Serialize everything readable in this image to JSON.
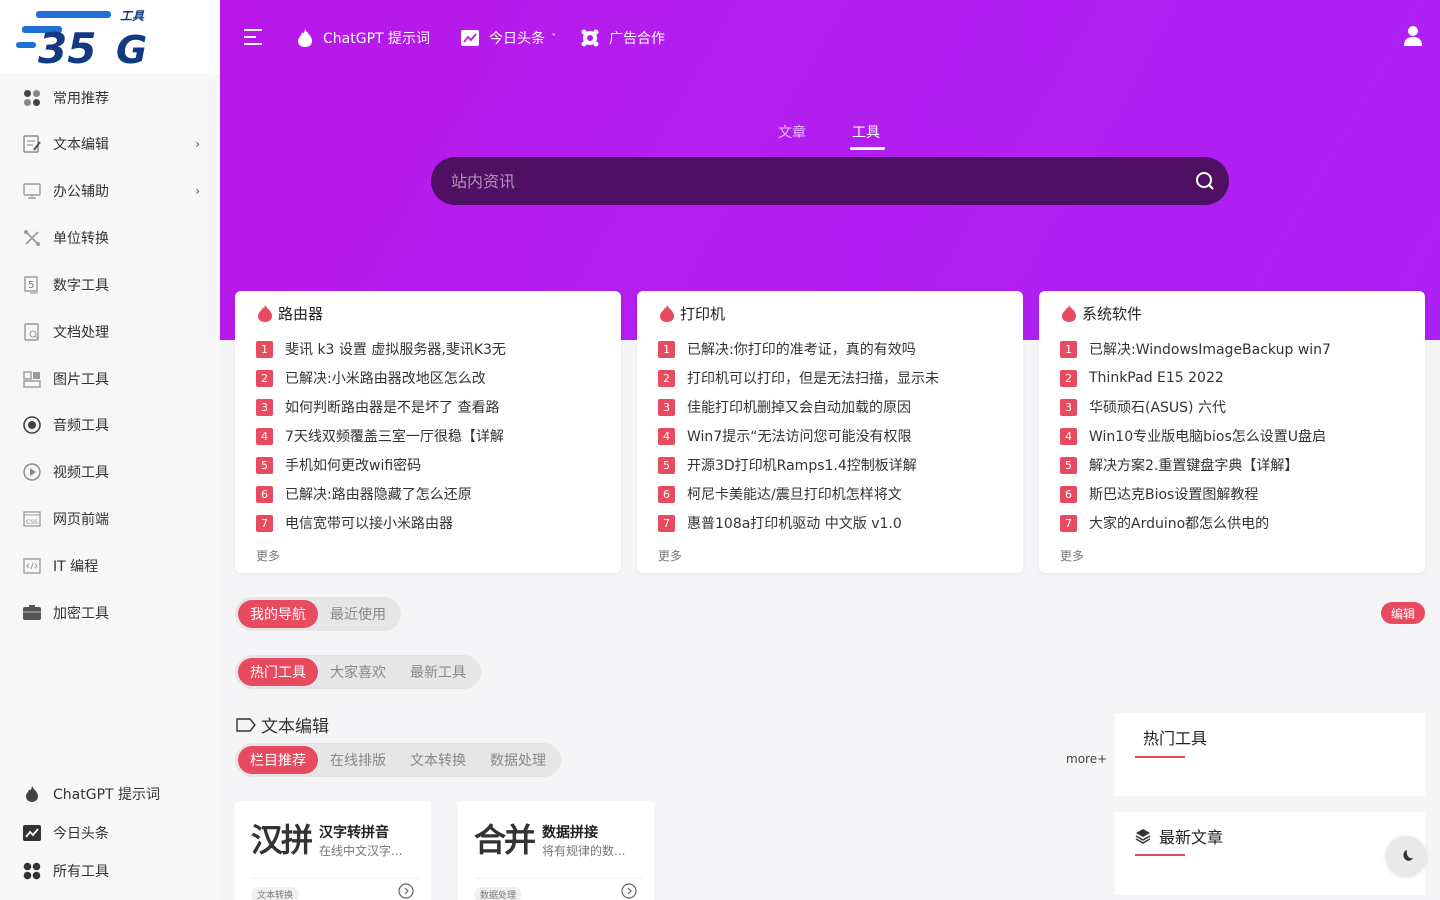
{
  "logo": {
    "text": "工具",
    "alt": "35G"
  },
  "sidebar": {
    "items": [
      {
        "label": "常用推荐",
        "icon": "grid-icon"
      },
      {
        "label": "文本编辑",
        "icon": "edit-icon",
        "arrow": "›"
      },
      {
        "label": "办公辅助",
        "icon": "monitor-icon",
        "arrow": "›"
      },
      {
        "label": "单位转换",
        "icon": "convert-icon"
      },
      {
        "label": "数字工具",
        "icon": "number-icon"
      },
      {
        "label": "文档处理",
        "icon": "document-icon"
      },
      {
        "label": "图片工具",
        "icon": "image-icon"
      },
      {
        "label": "音频工具",
        "icon": "audio-icon"
      },
      {
        "label": "视频工具",
        "icon": "video-icon"
      },
      {
        "label": "网页前端",
        "icon": "css-icon"
      },
      {
        "label": "IT 编程",
        "icon": "code-icon"
      },
      {
        "label": "加密工具",
        "icon": "lock-box-icon"
      }
    ],
    "footer": [
      {
        "label": "ChatGPT 提示词",
        "icon": "flame-icon"
      },
      {
        "label": "今日头条",
        "icon": "chart-icon"
      },
      {
        "label": "所有工具",
        "icon": "grid-icon"
      }
    ]
  },
  "topnav": {
    "items": [
      {
        "label": "ChatGPT 提示词",
        "icon": "flame-icon"
      },
      {
        "label": "今日头条",
        "icon": "chart-icon",
        "caret": "ˇ"
      },
      {
        "label": "广告合作",
        "icon": "shield-icon"
      }
    ]
  },
  "search": {
    "tabs": [
      "文章",
      "工具"
    ],
    "active_tab": "工具",
    "placeholder": "站内资讯"
  },
  "cards": [
    {
      "title": "路由器",
      "items": [
        "斐讯 k3 设置 虚拟服务器,斐讯K3无",
        "已解决:小米路由器改地区怎么改",
        "如何判断路由器是不是坏了 查看路",
        "7天线双频覆盖三室一厅很稳【详解",
        "手机如何更改wifi密码",
        "已解决:路由器隐藏了怎么还原",
        "电信宽带可以接小米路由器"
      ],
      "more": "更多"
    },
    {
      "title": "打印机",
      "items": [
        "已解决:你打印的准考证，真的有效吗",
        "打印机可以打印，但是无法扫描，显示未",
        "佳能打印机删掉又会自动加载的原因",
        "Win7提示“无法访问您可能没有权限",
        "开源3D打印机Ramps1.4控制板详解",
        "柯尼卡美能达/震旦打印机怎样将文",
        "惠普108a打印机驱动 中文版 v1.0"
      ],
      "more": "更多"
    },
    {
      "title": "系统软件",
      "items": [
        "已解决:WindowsImageBackup win7",
        "ThinkPad E15 2022",
        "华硕顽石(ASUS) 六代",
        "Win10专业版电脑bios怎么设置U盘启",
        "解决方案2.重置键盘字典【详解】",
        "斯巴达克Bios设置图解教程",
        "大家的Arduino都怎么供电的"
      ],
      "more": "更多"
    }
  ],
  "nav_tabs": {
    "items": [
      "我的导航",
      "最近使用"
    ],
    "edit": "编辑"
  },
  "hot_tabs": {
    "items": [
      "热门工具",
      "大家喜欢",
      "最新工具"
    ]
  },
  "section": {
    "title": "文本编辑",
    "tabs": [
      "栏目推荐",
      "在线排版",
      "文本转换",
      "数据处理"
    ],
    "more": "more+"
  },
  "tools": [
    {
      "big": "汉拼",
      "name": "汉字转拼音",
      "desc": "在线中文汉字...",
      "tag": "文本转换"
    },
    {
      "big": "合并",
      "name": "数据拼接",
      "desc": "将有规律的数...",
      "tag": "数据处理"
    }
  ],
  "widgets": {
    "hot": "热门工具",
    "latest": "最新文章"
  },
  "colors": {
    "accent": "#e84a5f",
    "hero": "#b41ef0"
  }
}
